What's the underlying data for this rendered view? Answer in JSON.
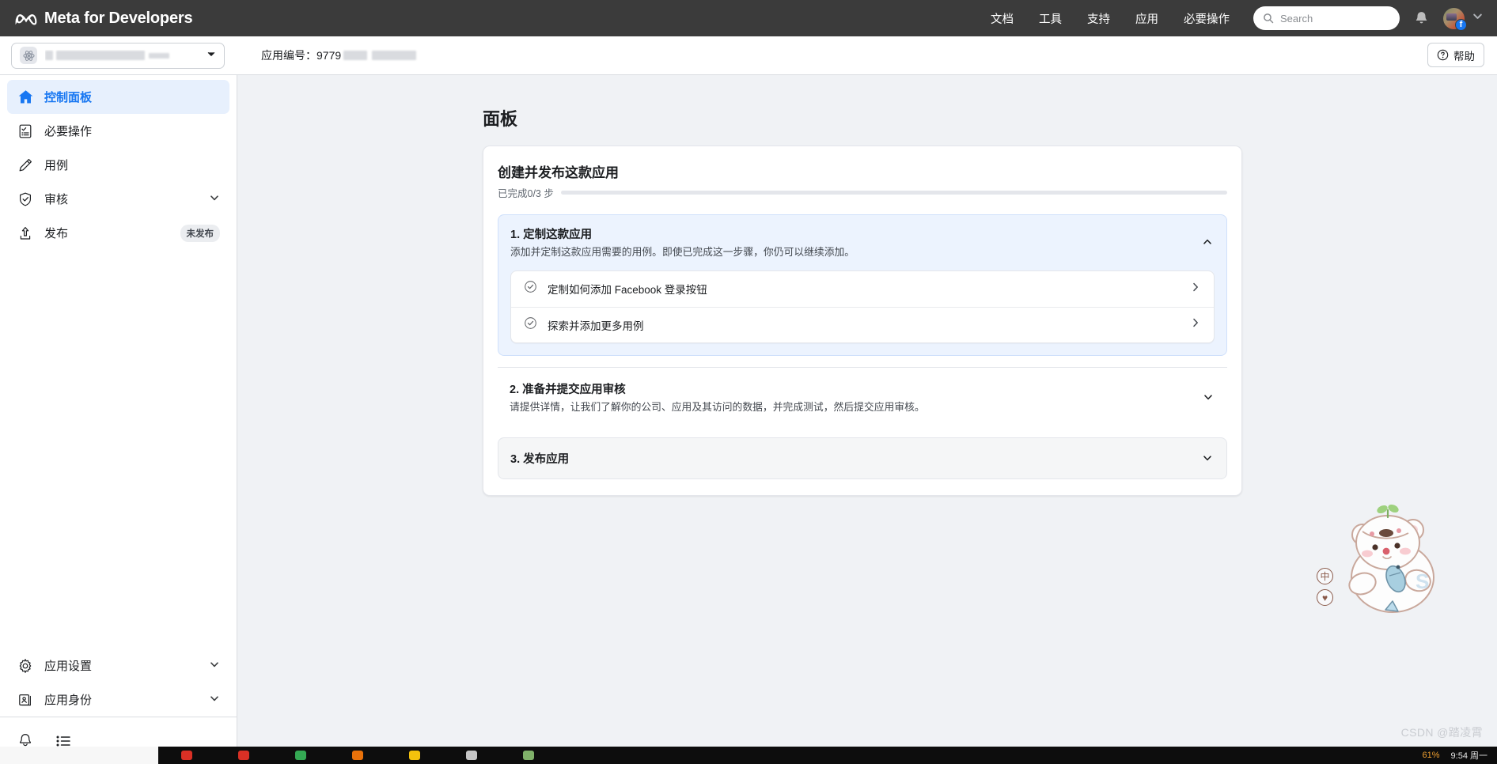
{
  "topnav": {
    "brand": "Meta for Developers",
    "links": [
      "文档",
      "工具",
      "支持",
      "应用",
      "必要操作"
    ],
    "search_placeholder": "Search",
    "search_value": "",
    "avatar_badge": "f"
  },
  "subbar": {
    "app_name_redacted": "",
    "app_id_label": "应用编号：",
    "app_id_value": "9779",
    "help_label": "帮助"
  },
  "sidebar": {
    "items": [
      {
        "label": "控制面板",
        "icon": "home-icon",
        "active": true
      },
      {
        "label": "必要操作",
        "icon": "checklist-icon",
        "active": false
      },
      {
        "label": "用例",
        "icon": "pencil-icon",
        "active": false
      },
      {
        "label": "审核",
        "icon": "shield-check-icon",
        "active": false,
        "chevron": true
      },
      {
        "label": "发布",
        "icon": "upload-icon",
        "active": false,
        "badge": "未发布"
      }
    ],
    "bottom_items": [
      {
        "label": "应用设置",
        "icon": "gear-icon",
        "chevron": true
      },
      {
        "label": "应用身份",
        "icon": "id-card-icon",
        "chevron": true
      }
    ],
    "footer_icons": [
      "bell-icon",
      "list-icon"
    ]
  },
  "main": {
    "page_title": "面板",
    "card": {
      "title": "创建并发布这款应用",
      "progress_label": "已完成0/3 步",
      "progress_percent": 0,
      "steps": [
        {
          "number": "1.",
          "title": "定制这款应用",
          "desc": "添加并定制这款应用需要的用例。即使已完成这一步骤，你仍可以继续添加。",
          "expanded": true,
          "sub_items": [
            {
              "label": "定制如何添加 Facebook 登录按钮"
            },
            {
              "label": "探索并添加更多用例"
            }
          ]
        },
        {
          "number": "2.",
          "title": "准备并提交应用审核",
          "desc": "请提供详情，让我们了解你的公司、应用及其访问的数据，并完成测试，然后提交应用审核。",
          "expanded": false,
          "sub_items": []
        },
        {
          "number": "3.",
          "title": "发布应用",
          "desc": "",
          "expanded": false,
          "sub_items": []
        }
      ]
    }
  },
  "ime": {
    "mode_button": "中",
    "shape_button": "♥"
  },
  "watermark": "CSDN @踏凌霄",
  "taskbar": {
    "battery": "61%",
    "clock": "9:54 周一"
  },
  "colors": {
    "brand_blue": "#1877f2",
    "topnav_bg": "#3b3b3b",
    "page_bg": "#f0f2f5",
    "active_item_bg": "#e7f0fd",
    "step_open_bg": "#ecf3fe"
  }
}
